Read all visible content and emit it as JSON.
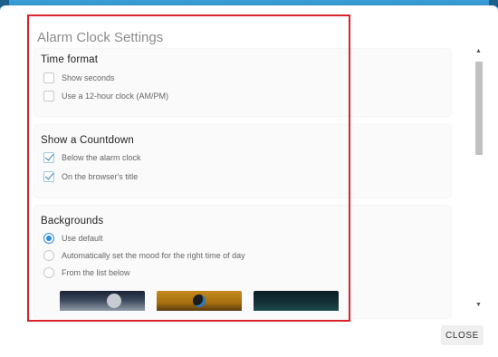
{
  "dialog": {
    "title": "Alarm Clock Settings",
    "close_label": "CLOSE"
  },
  "time_format": {
    "title": "Time format",
    "options": [
      {
        "label": "Show seconds",
        "checked": false
      },
      {
        "label": "Use a 12-hour clock (AM/PM)",
        "checked": false
      }
    ]
  },
  "countdown": {
    "title": "Show a Countdown",
    "options": [
      {
        "label": "Below the alarm clock",
        "checked": true
      },
      {
        "label": "On the browser's title",
        "checked": true
      }
    ]
  },
  "backgrounds": {
    "title": "Backgrounds",
    "options": [
      {
        "label": "Use default",
        "selected": true
      },
      {
        "label": "Automatically set the mood for the right time of day",
        "selected": false
      },
      {
        "label": "From the list below",
        "selected": false
      }
    ],
    "thumbnails": [
      "moon-landscape",
      "bird-on-orange",
      "dark-teal-night"
    ]
  },
  "colors": {
    "accent": "#2b8be0",
    "highlight_outline": "#d9232b",
    "header_bar": "#2f86bf"
  }
}
